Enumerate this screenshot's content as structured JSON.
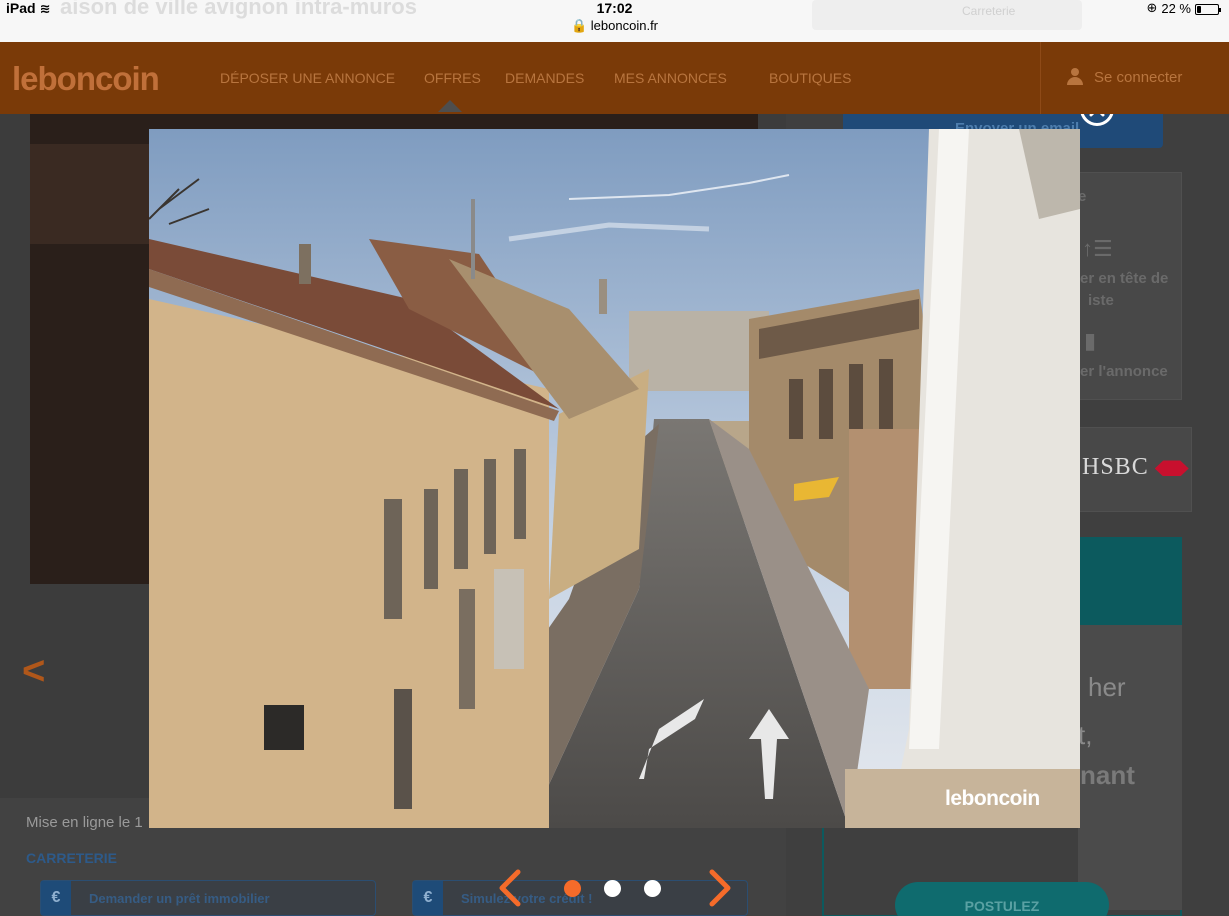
{
  "status_bar": {
    "device": "iPad",
    "time": "17:02",
    "url": "leboncoin.fr",
    "battery": "22 %",
    "battery_level": 0.22
  },
  "background_page": {
    "title_partial": "aison de ville avignon intra-muros",
    "top_chip": "Carreterie",
    "header": {
      "logo": "leboncoin",
      "nav": [
        "DÉPOSER UNE ANNONCE",
        "OFFRES",
        "DEMANDES",
        "MES ANNONCES",
        "BOUTIQUES"
      ],
      "active_nav": "OFFRES",
      "login": "Se connecter"
    },
    "email_button": "Envoyer un email",
    "actions": {
      "top_up_line1": "er en tête de",
      "top_up_line2": "iste",
      "delete": "er l'annonce",
      "partial_e": "e"
    },
    "partner": "HSBC",
    "ad": {
      "line1": "her",
      "line2": "t,",
      "line3": "nant",
      "cta": "POSTULEZ"
    },
    "published_partial": "Mise en ligne le 1",
    "location": "CARRETERIE",
    "buttons": [
      "Demander un prêt immobilier",
      "Simulez votre crédit !"
    ],
    "euro_symbol": "€"
  },
  "lightbox": {
    "watermark": "leboncoin",
    "slide_count": 3,
    "active_slide": 0
  },
  "colors": {
    "brand_orange": "#f56b2a",
    "header_dimmed": "#7a3a08",
    "overlay": "#2b2b2b"
  }
}
